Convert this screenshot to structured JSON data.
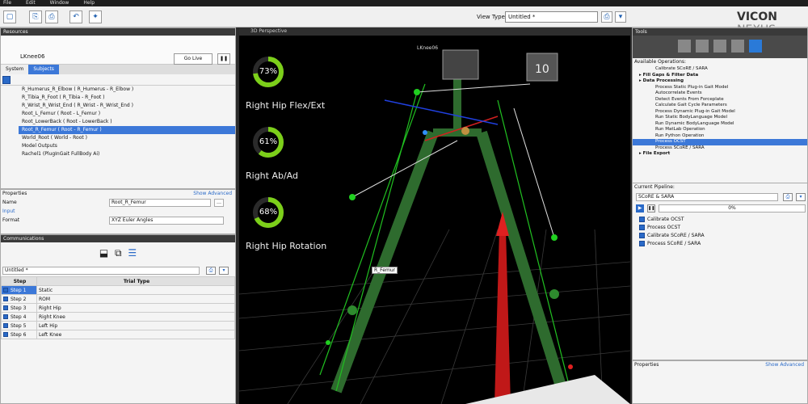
{
  "menu": [
    "File",
    "Edit",
    "Window",
    "Help"
  ],
  "toolbar": {
    "view_type_label": "View Type:",
    "view_type_value": "Untitled *"
  },
  "brand": {
    "name": "VICON",
    "suffix": "NEXUS"
  },
  "resources": {
    "title": "Resources",
    "trial_name": "LKnee06",
    "go_live_label": "Go Live",
    "tabs": [
      "System",
      "Subjects"
    ],
    "tree": [
      "R_Humerus_R_Elbow ( R_Humerus - R_Elbow )",
      "R_Tibia_R_Foot ( R_Tibia - R_Foot )",
      "R_Wrist_R_Wrist_End ( R_Wrist - R_Wrist_End )",
      "Root_L_Femur ( Root - L_Femur )",
      "Root_LowerBack ( Root - LowerBack )",
      "Root_R_Femur ( Root - R_Femur )",
      "World_Root ( World - Root )",
      "Model Outputs",
      "Rachel1 (PlugInGait FullBody Ai)"
    ]
  },
  "properties_left": {
    "title": "Properties",
    "show_advanced": "Show Advanced",
    "name_label": "Name",
    "name_value": "Root_R_Femur",
    "section_label": "Input",
    "format_label": "Format",
    "format_value": "XYZ Euler Angles"
  },
  "communications": {
    "title": "Communications",
    "pipeline_value": "Untitled *",
    "col_step": "Step",
    "col_trial_type": "Trial Type",
    "steps": [
      {
        "step": "Step 1",
        "type": "Static"
      },
      {
        "step": "Step 2",
        "type": "ROM"
      },
      {
        "step": "Step 3",
        "type": "Right Hip"
      },
      {
        "step": "Step 4",
        "type": "Right Knee"
      },
      {
        "step": "Step 5",
        "type": "Left Hip"
      },
      {
        "step": "Step 6",
        "type": "Left Knee"
      }
    ]
  },
  "viewport": {
    "title": "3D Perspective",
    "subject_label": "LKnee06",
    "segment_label": "R_Femur",
    "gauges": [
      {
        "value": "73%",
        "label": "Right Hip Flex/Ext",
        "fraction": 0.73
      },
      {
        "value": "61%",
        "label": "Right Ab/Ad",
        "fraction": 0.61
      },
      {
        "value": "68%",
        "label": "Right Hip Rotation",
        "fraction": 0.68
      }
    ]
  },
  "tools": {
    "title": "Tools",
    "available_label": "Available Operations:",
    "operations": [
      {
        "text": "Calibrate SCoRE / SARA",
        "bold": false
      },
      {
        "text": "Fill Gaps & Filter Data",
        "bold": true
      },
      {
        "text": "Data Processing",
        "bold": true
      },
      {
        "text": "Process Static Plug-in Gait Model",
        "bold": false
      },
      {
        "text": "Autocorrelate Events",
        "bold": false
      },
      {
        "text": "Detect Events From Forceplate",
        "bold": false
      },
      {
        "text": "Calculate Gait Cycle Parameters",
        "bold": false
      },
      {
        "text": "Process Dynamic Plug-in Gait Model",
        "bold": false
      },
      {
        "text": "Run Static BodyLanguage Model",
        "bold": false
      },
      {
        "text": "Run Dynamic BodyLanguage Model",
        "bold": false
      },
      {
        "text": "Run MatLab Operation",
        "bold": false
      },
      {
        "text": "Run Python Operation",
        "bold": false
      },
      {
        "text": "Process OCST",
        "bold": false
      },
      {
        "text": "Process SCoRE / SARA",
        "bold": false
      },
      {
        "text": "File Export",
        "bold": true
      }
    ],
    "current_pipeline_label": "Current Pipeline:",
    "pipeline_value": "SCoRE & SARA",
    "progress_text": "0%",
    "progress_fraction": 0,
    "pipeline_items": [
      "Calibrate OCST",
      "Process OCST",
      "Calibrate SCoRE / SARA",
      "Process SCoRE / SARA"
    ],
    "properties_label": "Properties",
    "show_advanced": "Show Advanced"
  }
}
